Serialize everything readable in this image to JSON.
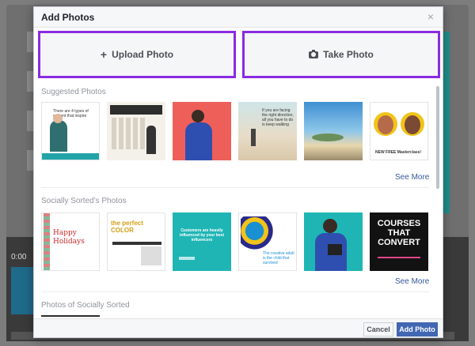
{
  "background": {
    "time": "0:00"
  },
  "modal": {
    "title": "Add Photos",
    "close_icon": "close-icon",
    "upload_label": "Upload Photo",
    "take_label": "Take Photo"
  },
  "sections": {
    "suggested": {
      "title": "Suggested Photos",
      "see_more": "See More",
      "photos": [
        {
          "caption": "There are 4 types of content that inspire"
        },
        {
          "caption": ""
        },
        {
          "caption": ""
        },
        {
          "caption": "If you are facing the right direction, all you have to do is keep walking"
        },
        {
          "caption": ""
        },
        {
          "caption": "NEW FREE Masterclass!"
        }
      ]
    },
    "socially_sorted": {
      "title": "Socially Sorted's Photos",
      "see_more": "See More",
      "photos": [
        {
          "caption": "Happy Holidays"
        },
        {
          "caption": "the perfect COLOR"
        },
        {
          "caption": "Customers are heavily influenced by your best influencers"
        },
        {
          "caption": "The creative adult is the child that survived"
        },
        {
          "caption": ""
        },
        {
          "caption": "COURSES THAT CONVERT"
        }
      ]
    },
    "photos_of": {
      "title": "Photos of Socially Sorted"
    }
  },
  "footer": {
    "cancel_label": "Cancel",
    "add_label": "Add Photo"
  },
  "colors": {
    "accent_purple": "#8a2be2",
    "fb_blue": "#4267b2",
    "link": "#365899"
  }
}
